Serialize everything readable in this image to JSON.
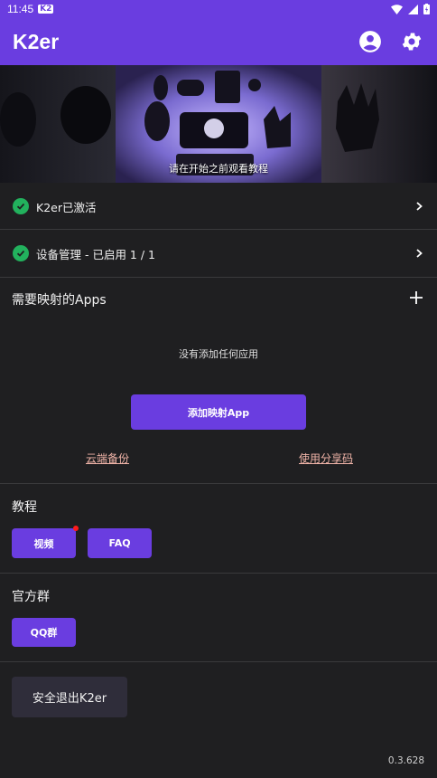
{
  "status_bar": {
    "time": "11:45",
    "carrier_badge": "K2"
  },
  "app_bar": {
    "title": "K2er",
    "icons": [
      "account-circle-icon",
      "settings-gear-icon"
    ]
  },
  "banner": {
    "caption": "请在开始之前观看教程"
  },
  "status_rows": [
    {
      "label": "K2er已激活",
      "icon": "check-circle-icon"
    },
    {
      "label": "设备管理 - 已启用 1 / 1",
      "icon": "check-circle-icon"
    }
  ],
  "mapped_apps": {
    "title": "需要映射的Apps",
    "empty_message": "没有添加任何应用",
    "add_button": "添加映射App",
    "cloud_backup_link": "云端备份",
    "share_code_link": "使用分享码"
  },
  "tutorial": {
    "title": "教程",
    "video_button": "视频",
    "faq_button": "FAQ"
  },
  "official_group": {
    "title": "官方群",
    "qq_button": "QQ群"
  },
  "exit_button": "安全退出K2er",
  "version": "0.3.628",
  "colors": {
    "primary": "#6a3de0",
    "background": "#1f1f21",
    "success": "#22b15d",
    "link": "#f0b4a8",
    "badge_dot": "#ff1a1a"
  }
}
